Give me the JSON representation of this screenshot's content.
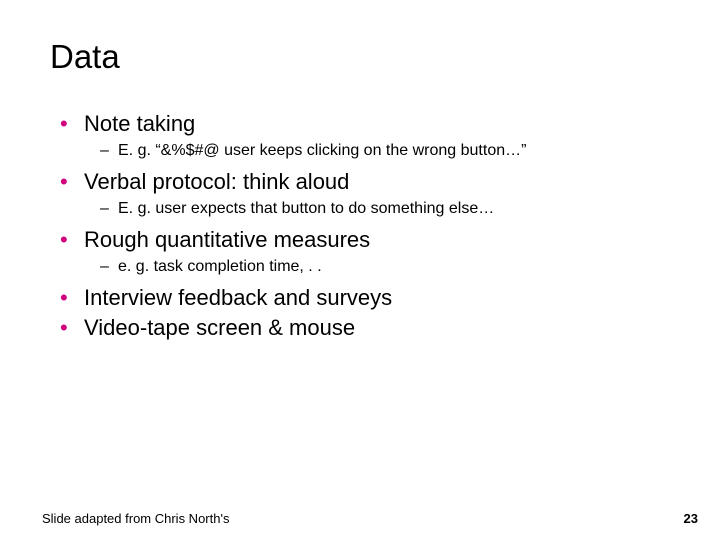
{
  "title": "Data",
  "bullets": [
    {
      "text": "Note taking",
      "subs": [
        "E. g. “&%$#@ user keeps clicking on the wrong button…”"
      ]
    },
    {
      "text": "Verbal protocol:  think aloud",
      "subs": [
        "E. g. user expects that button to do something else…"
      ]
    },
    {
      "text": "Rough quantitative measures",
      "subs": [
        "e. g. task completion time, . ."
      ]
    },
    {
      "text": "Interview feedback and surveys",
      "subs": []
    },
    {
      "text": "Video-tape screen & mouse",
      "subs": []
    }
  ],
  "footer": {
    "left": "Slide adapted from Chris North's",
    "right": "23"
  }
}
